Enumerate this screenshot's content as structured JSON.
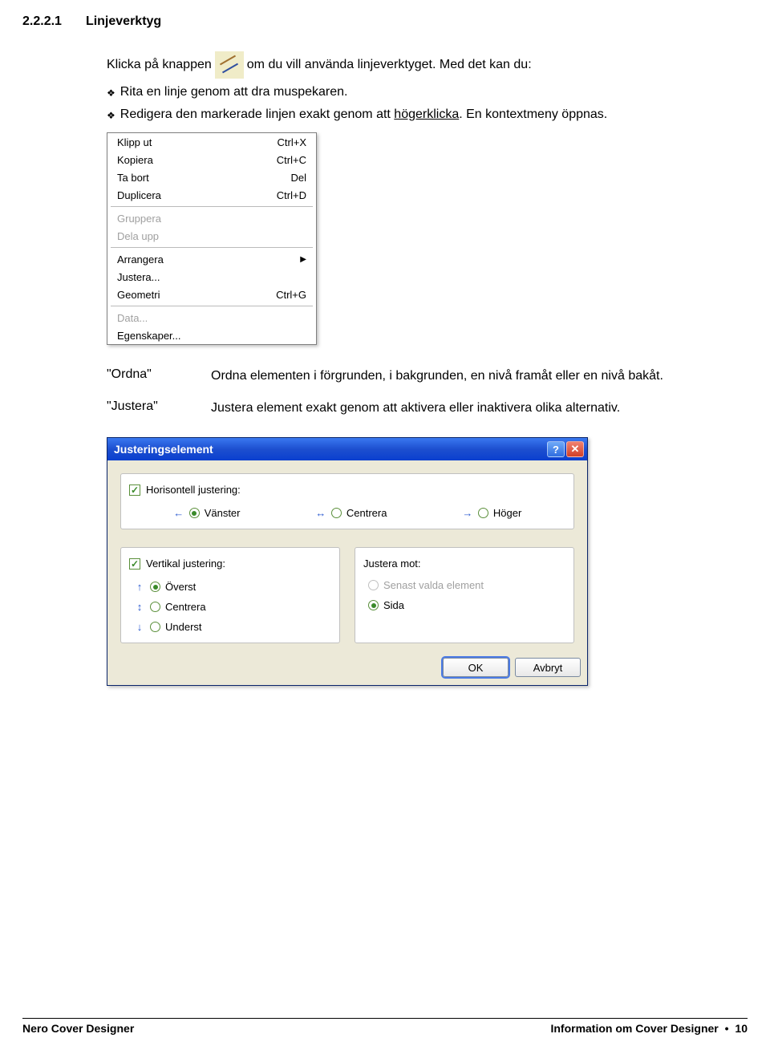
{
  "heading": {
    "number": "2.2.2.1",
    "title": "Linjeverktyg"
  },
  "intro": {
    "line1_before": "Klicka på knappen",
    "line1_after": "om du vill använda linjeverktyget. Med det kan du:",
    "bullet1": "Rita en linje genom att dra muspekaren.",
    "bullet2_before": "Redigera den markerade linjen exakt genom att ",
    "bullet2_underlined": "högerklicka",
    "bullet2_after": ". En kontextmeny öppnas."
  },
  "context_menu": {
    "r1": {
      "label": "Klipp ut",
      "shortcut": "Ctrl+X"
    },
    "r2": {
      "label": "Kopiera",
      "shortcut": "Ctrl+C"
    },
    "r3": {
      "label": "Ta bort",
      "shortcut": "Del"
    },
    "r4": {
      "label": "Duplicera",
      "shortcut": "Ctrl+D"
    },
    "r5": {
      "label": "Gruppera"
    },
    "r6": {
      "label": "Dela upp"
    },
    "r7": {
      "label": "Arrangera"
    },
    "r8": {
      "label": "Justera..."
    },
    "r9": {
      "label": "Geometri",
      "shortcut": "Ctrl+G"
    },
    "r10": {
      "label": "Data..."
    },
    "r11": {
      "label": "Egenskaper..."
    }
  },
  "desc": {
    "ordna_term": "\"Ordna\"",
    "ordna_def": "Ordna elementen i förgrunden, i bakgrunden, en nivå framåt eller en nivå bakåt.",
    "justera_term": "\"Justera\"",
    "justera_def": "Justera element exakt genom att aktivera eller inaktivera olika alternativ."
  },
  "dialog": {
    "title": "Justeringselement",
    "horiz_label": "Horisontell justering:",
    "h_left": "Vänster",
    "h_center": "Centrera",
    "h_right": "Höger",
    "vert_label": "Vertikal justering:",
    "v_top": "Överst",
    "v_center": "Centrera",
    "v_bottom": "Underst",
    "against_label": "Justera mot:",
    "against_last": "Senast valda element",
    "against_page": "Sida",
    "ok": "OK",
    "cancel": "Avbryt"
  },
  "footer": {
    "left": "Nero Cover Designer",
    "right_text": "Information om Cover Designer",
    "page": "10"
  }
}
